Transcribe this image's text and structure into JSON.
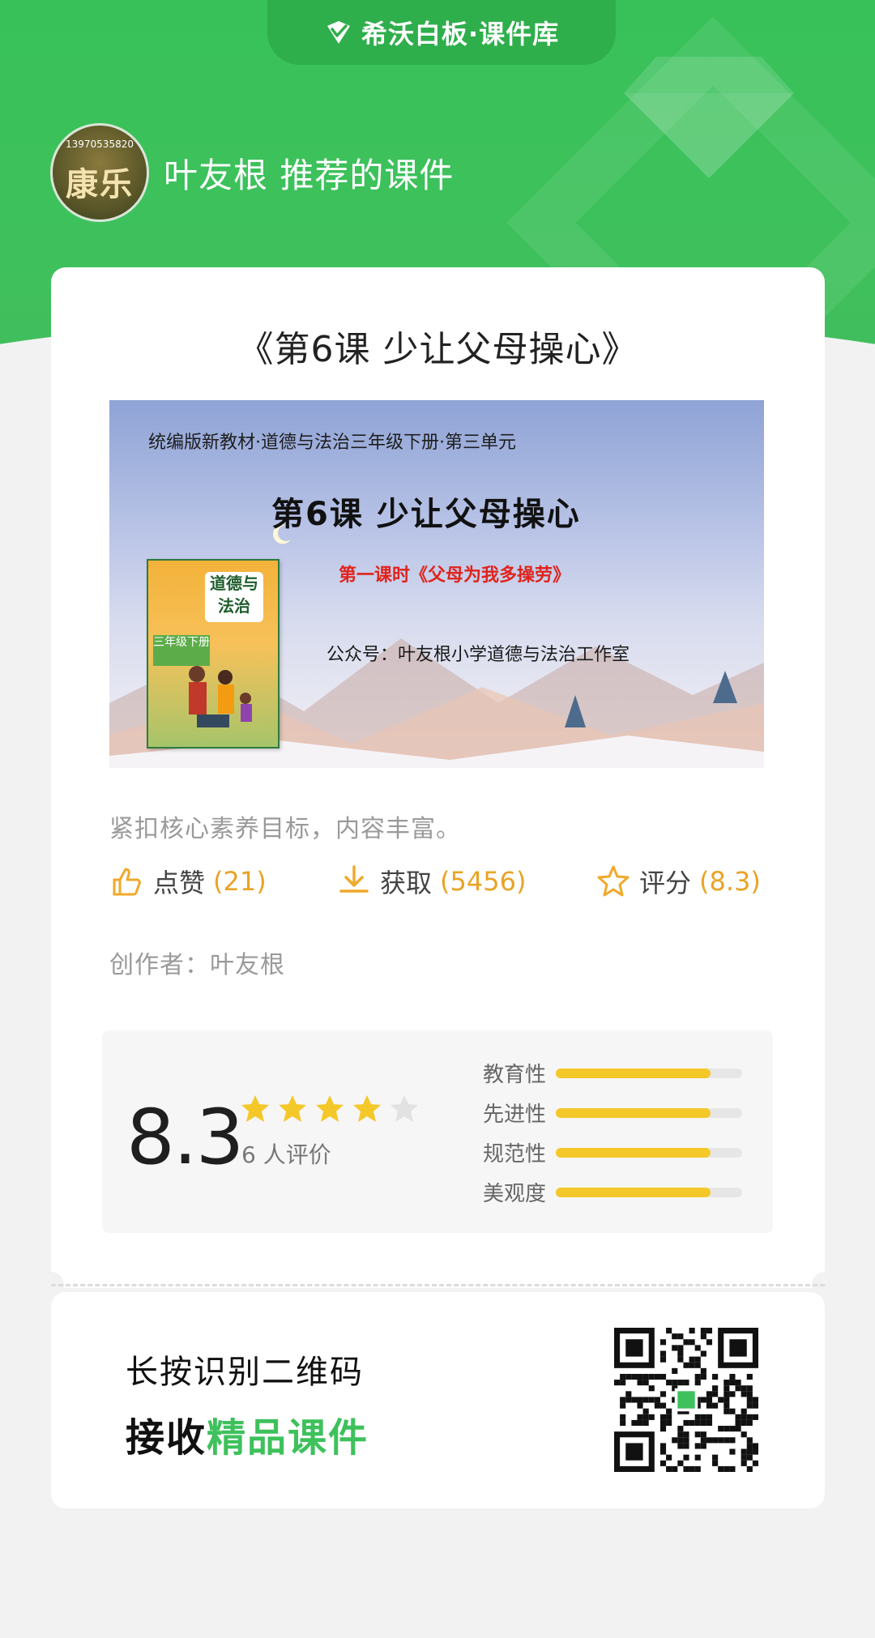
{
  "header": {
    "brand": "希沃白板·课件库",
    "avatar_phone": "13970535820",
    "avatar_name": "康乐",
    "recommender": "叶友根  推荐的课件"
  },
  "course": {
    "title": "《第6课 少让父母操心》",
    "cover": {
      "line1": "统编版新教材·道德与法治三年级下册·第三单元",
      "line2": "第6课    少让父母操心",
      "line3": "第一课时《父母为我多操劳》",
      "line4": "公众号：叶友根小学道德与法治工作室",
      "book_title": "道德与法治",
      "book_grade": "三年级下册"
    },
    "description": "紧扣核心素养目标，内容丰富。",
    "stats": {
      "like_label": "点赞",
      "like_count": "(21)",
      "get_label": "获取",
      "get_count": "(5456)",
      "rate_label": "评分",
      "rate_value": "(8.3)"
    },
    "author": "创作者：叶友根"
  },
  "rating": {
    "score": "8.3",
    "stars": 4,
    "star_max": 5,
    "count_text": "6 人评价",
    "dimensions": [
      {
        "label": "教育性",
        "value": 0.83
      },
      {
        "label": "先进性",
        "value": 0.83
      },
      {
        "label": "规范性",
        "value": 0.83
      },
      {
        "label": "美观度",
        "value": 0.83
      }
    ]
  },
  "qr_section": {
    "line1": "长按识别二维码",
    "line2_prefix": "接收",
    "line2_highlight": "精品课件"
  },
  "colors": {
    "brand_green": "#3ec15c",
    "accent_orange": "#e9a325",
    "star_yellow": "#f5c82a"
  }
}
